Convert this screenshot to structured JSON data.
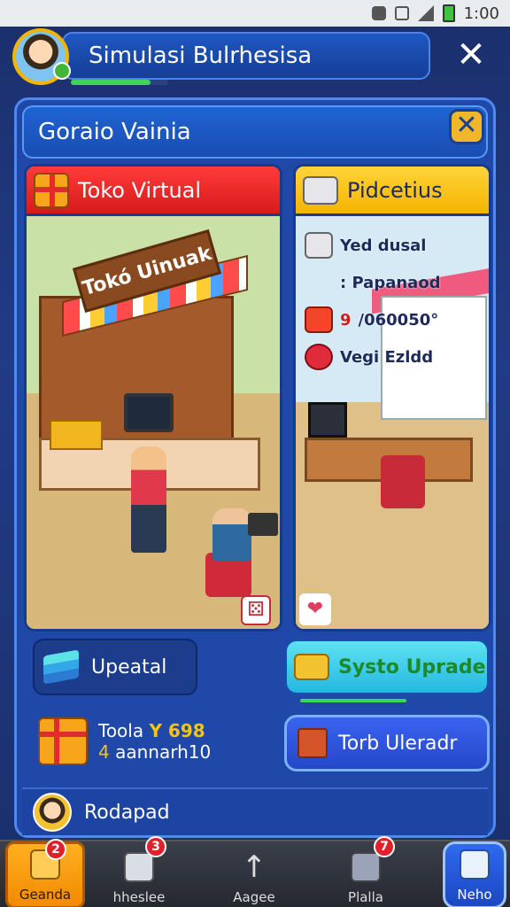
{
  "status_bar": {
    "time": "1:00"
  },
  "header": {
    "title": "Simulasi Bulrhesisa",
    "progress": 0.82
  },
  "panel": {
    "title": "Goraio Vainia"
  },
  "left_card": {
    "tab_label": "Toko Virtual",
    "sign_text": "Tokó Uinuak"
  },
  "right_card": {
    "tab_label": "Pidcetius",
    "stats": [
      {
        "text": "Yed dusal",
        "icon": "machine-icon"
      },
      {
        "text": ": Papanaod",
        "icon": "blank"
      },
      {
        "text": "/060050°",
        "prefix": "9",
        "icon": "gift-icon",
        "red": true
      },
      {
        "text": "Vegi Ezldd",
        "icon": "red-box-icon"
      }
    ]
  },
  "buttons": {
    "upgrade_label": "Upeatal",
    "system_upgrade_label": "Systo Uprade",
    "table_upgrade_label": "Torb Uleradr"
  },
  "today": {
    "label": "Toola",
    "value": "Y 698",
    "sub_prefix": "4",
    "sub": "aannarh10"
  },
  "bottom_strip": {
    "label": "Rodapad"
  },
  "nav": {
    "items": [
      {
        "label": "Geanda",
        "badge": "2"
      },
      {
        "label": "hheslee",
        "badge": "3"
      },
      {
        "label": "Aagee",
        "badge": ""
      },
      {
        "label": "Plalla",
        "badge": "7"
      },
      {
        "label": "Neho",
        "badge": ""
      }
    ]
  },
  "colors": {
    "accent_red": "#d61a1a",
    "accent_yellow": "#f4b400",
    "panel_blue": "#2048a8",
    "green": "#3fd45a"
  }
}
